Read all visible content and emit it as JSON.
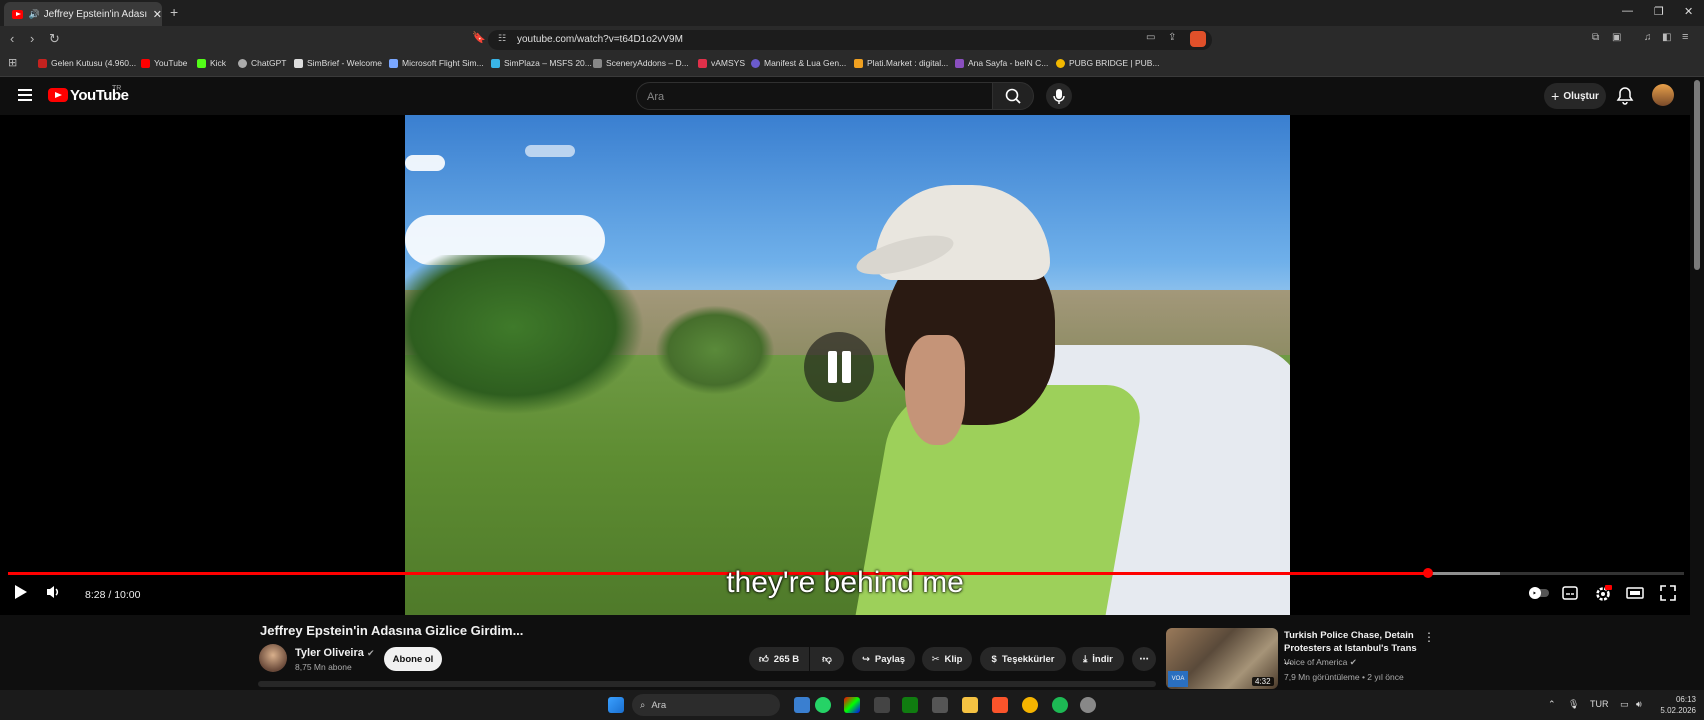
{
  "browser": {
    "tab_title": "Jeffrey Epstein'in Adasına Gizlice Girdim...",
    "tab_short": "Jeffrey Epstein'in Adasına Gizl",
    "url": "youtube.com/watch?v=t64D1o2vV9M",
    "bookmarks": [
      {
        "label": "Gelen Kutusu (4.960...",
        "color": "#c5221f"
      },
      {
        "label": "YouTube",
        "color": "#ff0000"
      },
      {
        "label": "Kick",
        "color": "#53fc18"
      },
      {
        "label": "ChatGPT",
        "color": "#aaaaaa"
      },
      {
        "label": "SimBrief - Welcome",
        "color": "#dddddd"
      },
      {
        "label": "Microsoft Flight Sim...",
        "color": "#7aa7ff"
      },
      {
        "label": "SimPlaza – MSFS 20...",
        "color": "#39b4e6"
      },
      {
        "label": "SceneryAddons – D...",
        "color": "#888888"
      },
      {
        "label": "vAMSYS",
        "color": "#e0304a"
      },
      {
        "label": "Manifest & Lua Gen...",
        "color": "#6a5acd"
      },
      {
        "label": "Plati.Market : digital...",
        "color": "#f0a020"
      },
      {
        "label": "Ana Sayfa - beIN C...",
        "color": "#8a4fbf"
      },
      {
        "label": "PUBG BRIDGE | PUB...",
        "color": "#f2b800"
      }
    ]
  },
  "youtube": {
    "logo_text": "YouTube",
    "region": "TR",
    "search_placeholder": "Ara",
    "create_label": "Oluştur"
  },
  "player": {
    "caption": "they're behind me",
    "time_display": "8:28 / 10:00",
    "progress_fraction": 0.847,
    "buffered_fraction": 0.89
  },
  "video": {
    "title": "Jeffrey Epstein'in Adasına Gizlice Girdim...",
    "channel_name": "Tyler Oliveira",
    "subscribers": "8,75 Mn abone",
    "subscribe_label": "Abone ol",
    "likes": "265 B",
    "share_label": "Paylaş",
    "clip_label": "Klip",
    "thanks_label": "Teşekkürler",
    "download_label": "İndir"
  },
  "recommendation": {
    "title": "Turkish Police Chase, Detain Protesters at Istanbul's Trans ...",
    "channel": "Voice of America",
    "meta": "7,9 Mn görüntüleme • 2 yıl önce",
    "duration": "4:32",
    "badge": "VOA"
  },
  "taskbar": {
    "search_label": "Ara",
    "language": "TUR",
    "time": "06:13",
    "date": "5.02.2026"
  }
}
